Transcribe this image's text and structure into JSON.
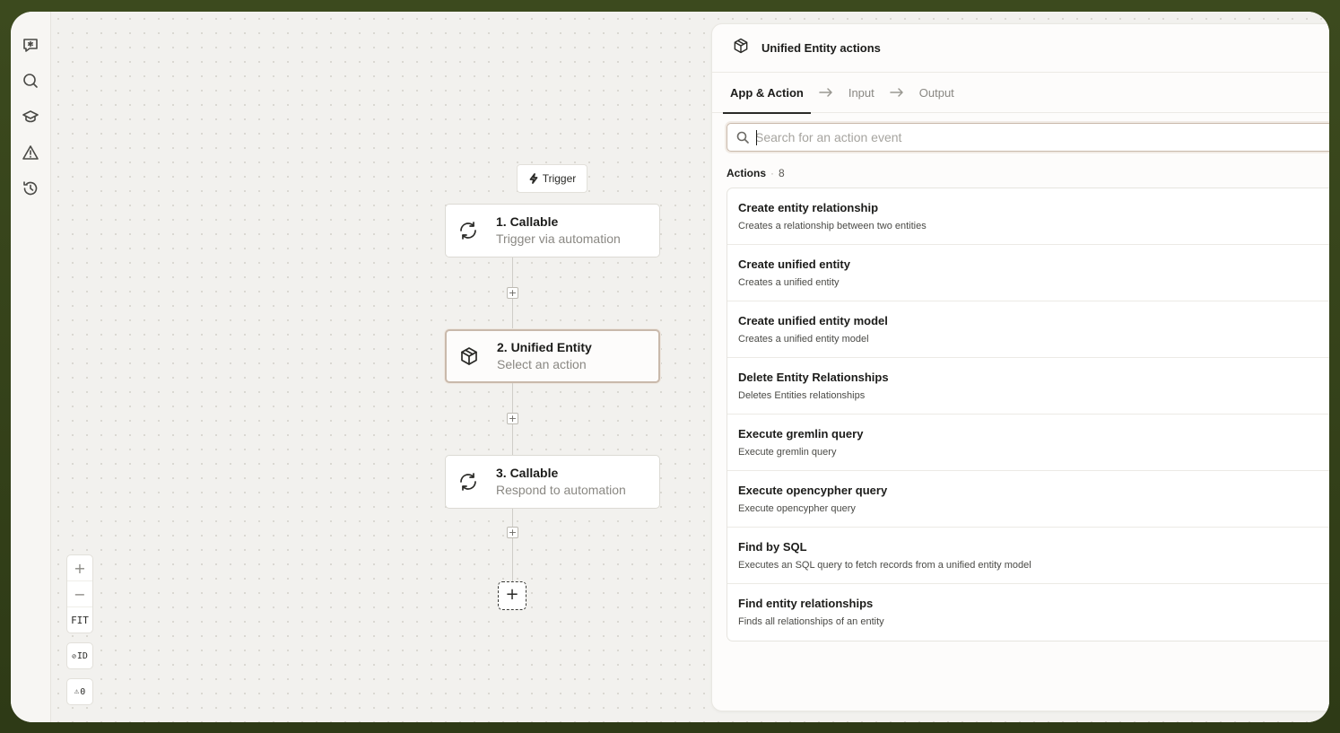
{
  "canvas": {
    "trigger_label": "Trigger",
    "nodes": [
      {
        "title": "1. Callable",
        "subtitle": "Trigger via automation",
        "icon": "refresh-icon"
      },
      {
        "title": "2. Unified Entity",
        "subtitle": "Select an action",
        "icon": "package-icon"
      },
      {
        "title": "3. Callable",
        "subtitle": "Respond to automation",
        "icon": "refresh-icon"
      }
    ],
    "zoom": {
      "in": "+",
      "out": "−",
      "fit": "FIT"
    },
    "id_toggle": "ID",
    "warnings_count": "0"
  },
  "panel": {
    "title": "Unified Entity actions",
    "tabs": [
      "App & Action",
      "Input",
      "Output"
    ],
    "search": {
      "placeholder": "Search for an action event",
      "value": ""
    },
    "actions_label": "Actions",
    "actions_count": "8",
    "actions": [
      {
        "title": "Create entity relationship",
        "desc": "Creates a relationship between two entities"
      },
      {
        "title": "Create unified entity",
        "desc": "Creates a unified entity"
      },
      {
        "title": "Create unified entity model",
        "desc": "Creates a unified entity model"
      },
      {
        "title": "Delete Entity Relationships",
        "desc": "Deletes Entities relationships"
      },
      {
        "title": "Execute gremlin query",
        "desc": "Execute gremlin query"
      },
      {
        "title": "Execute opencypher query",
        "desc": "Execute opencypher query"
      },
      {
        "title": "Find by SQL",
        "desc": "Executes an SQL query to fetch records from a unified entity model"
      },
      {
        "title": "Find entity relationships",
        "desc": "Finds all relationships of an entity"
      }
    ]
  },
  "colors": {
    "accent_border": "#c9b9ab",
    "frame": "#3c4a1e"
  }
}
